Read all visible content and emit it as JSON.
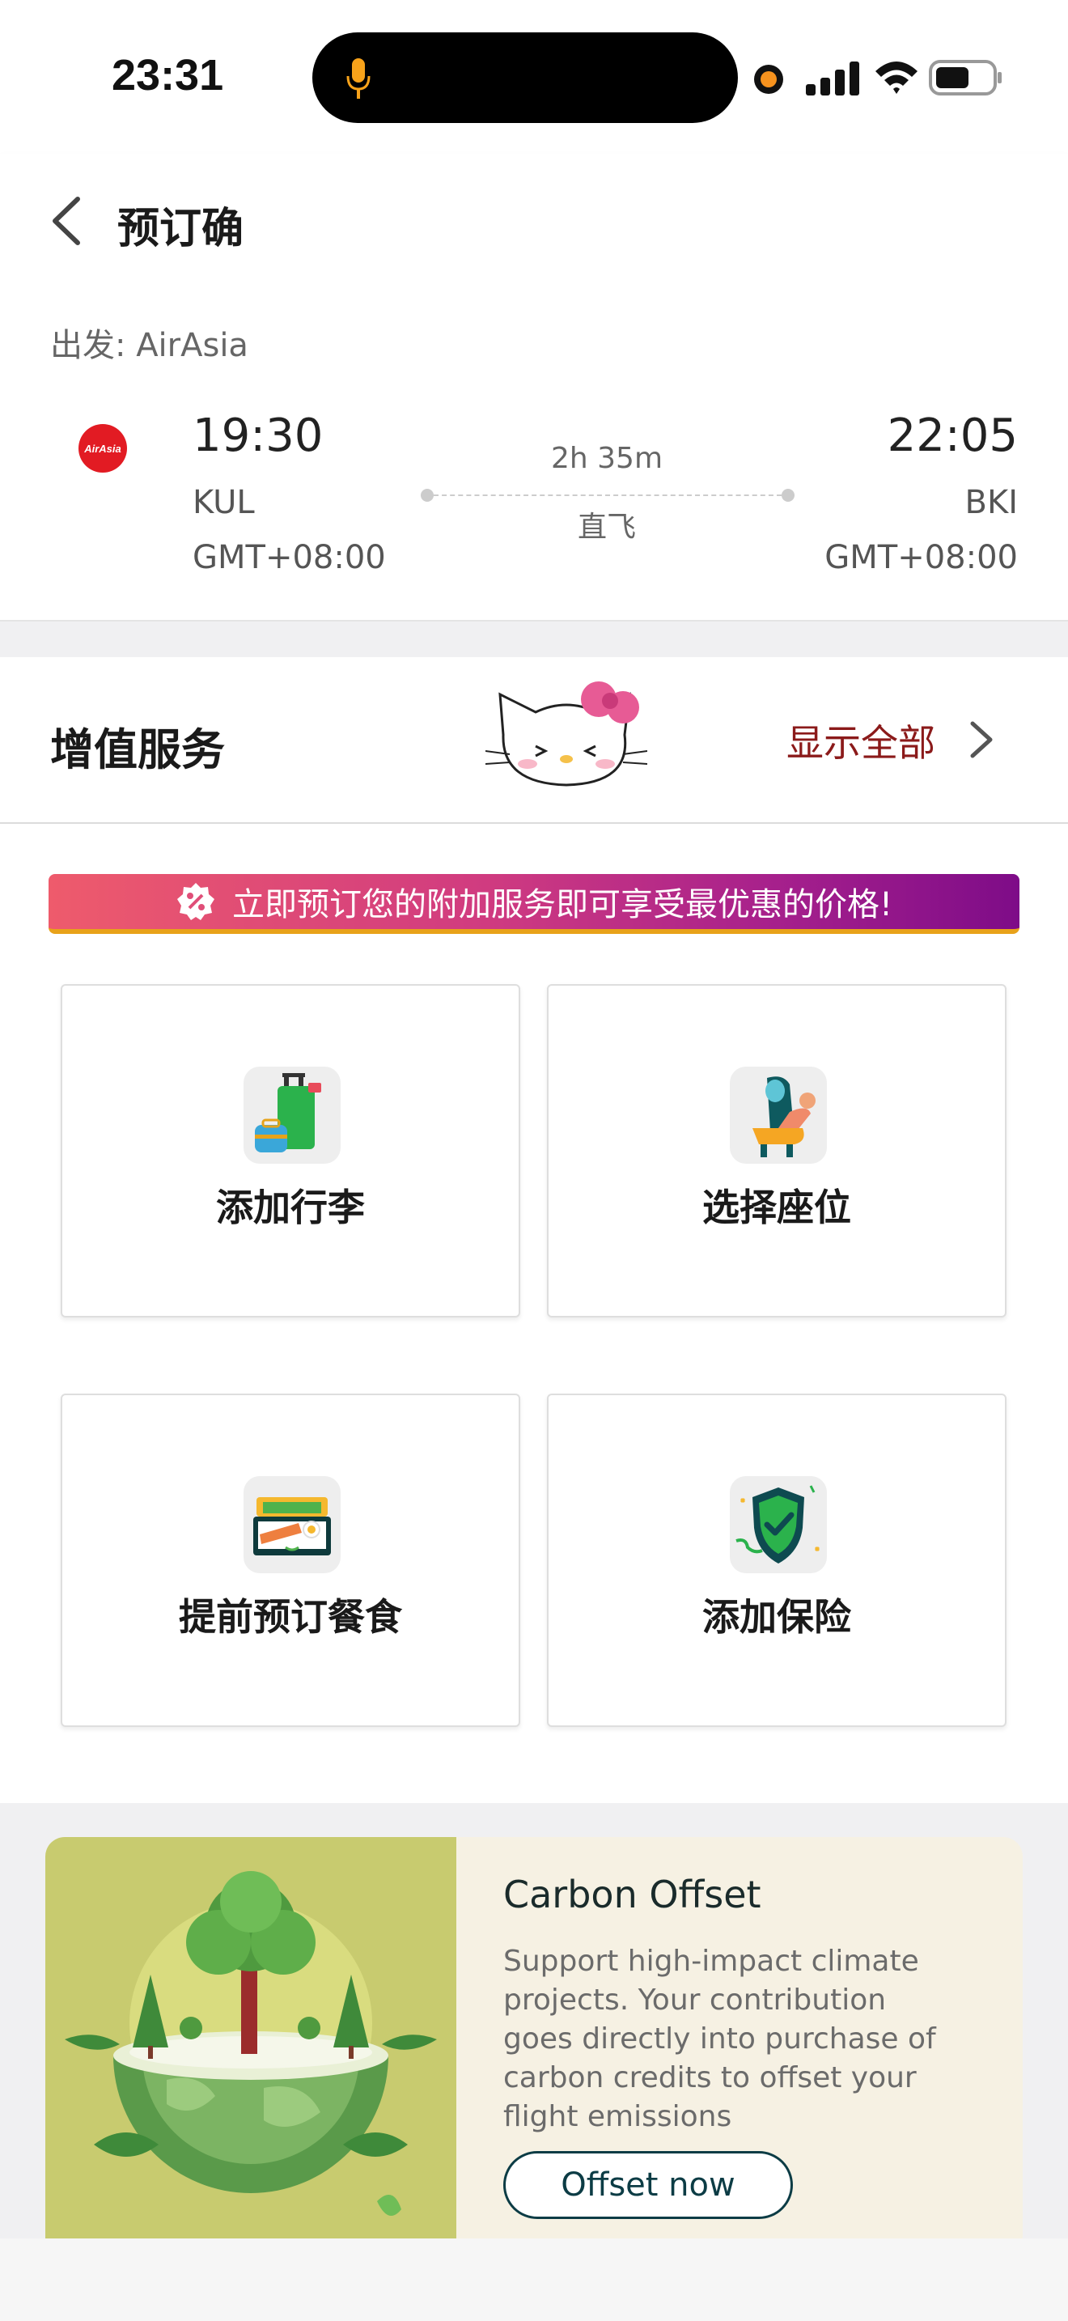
{
  "status_bar": {
    "time": "23:31",
    "icons": [
      "mic-icon",
      "recording-dot-icon",
      "cellular-signal-icon",
      "wifi-icon",
      "battery-icon"
    ]
  },
  "header": {
    "title": "预订确"
  },
  "flight": {
    "departure_label": "出发: AirAsia",
    "airline_logo_text": "AirAsia",
    "depart_time": "19:30",
    "depart_code": "KUL",
    "depart_tz": "GMT+08:00",
    "arrive_time": "22:05",
    "arrive_code": "BKI",
    "arrive_tz": "GMT+08:00",
    "duration": "2h 35m",
    "stops": "直飞"
  },
  "addons": {
    "title": "增值服务",
    "show_all": "显示全部",
    "promo": "立即预订您的附加服务即可享受最优惠的价格!",
    "cards": [
      {
        "label": "添加行李",
        "icon": "luggage-icon"
      },
      {
        "label": "选择座位",
        "icon": "seat-icon"
      },
      {
        "label": "提前预订餐食",
        "icon": "meal-icon"
      },
      {
        "label": "添加保险",
        "icon": "insurance-shield-icon"
      }
    ]
  },
  "carbon": {
    "title": "Carbon Offset",
    "description": "Support high-impact climate projects. Your contribution goes directly into purchase of carbon credits to offset your flight emissions",
    "button": "Offset now"
  },
  "colors": {
    "airasia_red": "#e21b23",
    "show_all": "#8b1a1a",
    "promo_start": "#ee5b6c",
    "promo_end": "#7e0c88",
    "carbon_button": "#0c3c45"
  }
}
